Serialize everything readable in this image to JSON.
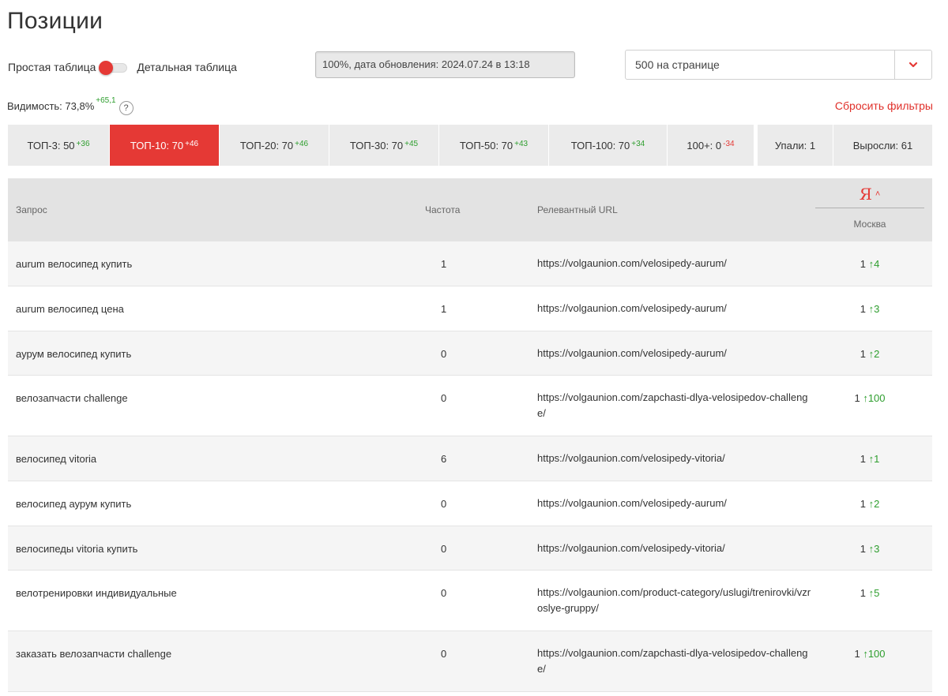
{
  "page": {
    "title": "Позиции"
  },
  "view_toggle": {
    "left_label": "Простая таблица",
    "right_label": "Детальная таблица"
  },
  "status": {
    "text": "100%, дата обновления: 2024.07.24 в 13:18"
  },
  "per_page": {
    "value": "500 на странице",
    "icon": "chevron-down-icon"
  },
  "visibility": {
    "label": "Видимость: 73,8%",
    "delta": "+65,1",
    "help_glyph": "?"
  },
  "reset_filters": "Сбросить фильтры",
  "tabs": [
    {
      "label": "ТОП-3: 50",
      "delta": "+36",
      "dir": "up",
      "active": false
    },
    {
      "label": "ТОП-10: 70",
      "delta": "+46",
      "dir": "up",
      "active": true
    },
    {
      "label": "ТОП-20: 70",
      "delta": "+46",
      "dir": "up",
      "active": false
    },
    {
      "label": "ТОП-30: 70",
      "delta": "+45",
      "dir": "up",
      "active": false
    },
    {
      "label": "ТОП-50: 70",
      "delta": "+43",
      "dir": "up",
      "active": false
    },
    {
      "label": "ТОП-100: 70",
      "delta": "+34",
      "dir": "up",
      "active": false
    },
    {
      "label": "100+: 0",
      "delta": "-34",
      "dir": "down",
      "active": false
    },
    {
      "label": "Упали: 1",
      "delta": "",
      "dir": "",
      "active": false
    },
    {
      "label": "Выросли: 61",
      "delta": "",
      "dir": "",
      "active": false
    }
  ],
  "table": {
    "headers": {
      "query": "Запрос",
      "frequency": "Частота",
      "url": "Релевантный URL",
      "engine": "Я",
      "region": "Москва"
    },
    "colors": {
      "accent": "#e53935",
      "positive": "#2e9e2e",
      "header_bg": "#e3e3e3",
      "row_alt": "#f5f5f5"
    },
    "rows": [
      {
        "query": "aurum велосипед купить",
        "frequency": "1",
        "url": "https://volgaunion.com/velosipedy-aurum/",
        "position": "1",
        "change": "4"
      },
      {
        "query": "aurum велосипед цена",
        "frequency": "1",
        "url": "https://volgaunion.com/velosipedy-aurum/",
        "position": "1",
        "change": "3"
      },
      {
        "query": "аурум велосипед купить",
        "frequency": "0",
        "url": "https://volgaunion.com/velosipedy-aurum/",
        "position": "1",
        "change": "2"
      },
      {
        "query": "велозапчасти challenge",
        "frequency": "0",
        "url": "https://volgaunion.com/zapchasti-dlya-velosipedov-challenge/",
        "position": "1",
        "change": "100"
      },
      {
        "query": "велосипед vitoria",
        "frequency": "6",
        "url": "https://volgaunion.com/velosipedy-vitoria/",
        "position": "1",
        "change": "1"
      },
      {
        "query": "велосипед аурум купить",
        "frequency": "0",
        "url": "https://volgaunion.com/velosipedy-aurum/",
        "position": "1",
        "change": "2"
      },
      {
        "query": "велосипеды vitoria купить",
        "frequency": "0",
        "url": "https://volgaunion.com/velosipedy-vitoria/",
        "position": "1",
        "change": "3"
      },
      {
        "query": "велотренировки индивидуальные",
        "frequency": "0",
        "url": "https://volgaunion.com/product-category/uslugi/trenirovki/vzroslye-gruppy/",
        "position": "1",
        "change": "5"
      },
      {
        "query": "заказать велозапчасти challenge",
        "frequency": "0",
        "url": "https://volgaunion.com/zapchasti-dlya-velosipedov-challenge/",
        "position": "1",
        "change": "100"
      }
    ]
  }
}
